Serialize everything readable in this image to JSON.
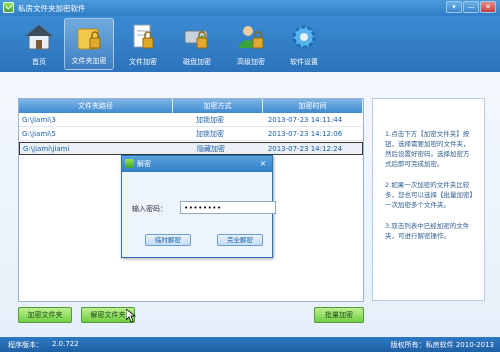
{
  "window": {
    "title": "私房文件夹加密软件",
    "controls": [
      "▾",
      "—",
      "✕"
    ]
  },
  "toolbar": {
    "items": [
      {
        "label": "首页",
        "icon": "home-icon"
      },
      {
        "label": "文件夹加密",
        "icon": "folder-lock-icon",
        "active": true
      },
      {
        "label": "文件加密",
        "icon": "file-lock-icon"
      },
      {
        "label": "磁盘加密",
        "icon": "disk-lock-icon"
      },
      {
        "label": "高级加密",
        "icon": "user-lock-icon"
      },
      {
        "label": "软件设置",
        "icon": "gear-icon"
      }
    ]
  },
  "table": {
    "headers": [
      "文件夹路径",
      "加密方式",
      "加密时间"
    ],
    "rows": [
      {
        "path": "G:\\jiami\\3",
        "method": "加锁加密",
        "time": "2013-07-23 14:11:44"
      },
      {
        "path": "G:\\jiami\\5",
        "method": "加锁加密",
        "time": "2013-07-23 14:12:06"
      },
      {
        "path": "G:\\jiami\\jiami",
        "method": "隐藏加密",
        "time": "2013-07-23 14:12:24"
      }
    ]
  },
  "info": {
    "p1": "1.点击下方【加密文件夹】按钮，选择需要加密的文件夹，然后设置好密码。选择加密方式后即可完成加密。",
    "p2": "2.如果一次加密的文件夹比较多，您也可以选择【批量加密】一次加密多个文件夹。",
    "p3": "3.双击列表中已经加密的文件夹，可进行解密操作。"
  },
  "buttons": {
    "encrypt_folder": "加密文件夹",
    "decrypt_folder": "解密文件夹",
    "batch_encrypt": "批量加密"
  },
  "dialog": {
    "title": "解密",
    "close": "×",
    "password_label": "输入密码：",
    "password_value": "••••••••",
    "temp_decrypt": "临时解密",
    "full_decrypt": "完全解密"
  },
  "status": {
    "version_label": "程序版本：",
    "version": "2.0.722",
    "copyright": "版权所有：私房软件 2010-2013"
  },
  "colors": {
    "titlebar": "#2f7ec6",
    "accent_green": "#6fcf45",
    "table_header": "#3f8ad0",
    "link_text": "#1b5ea6"
  }
}
